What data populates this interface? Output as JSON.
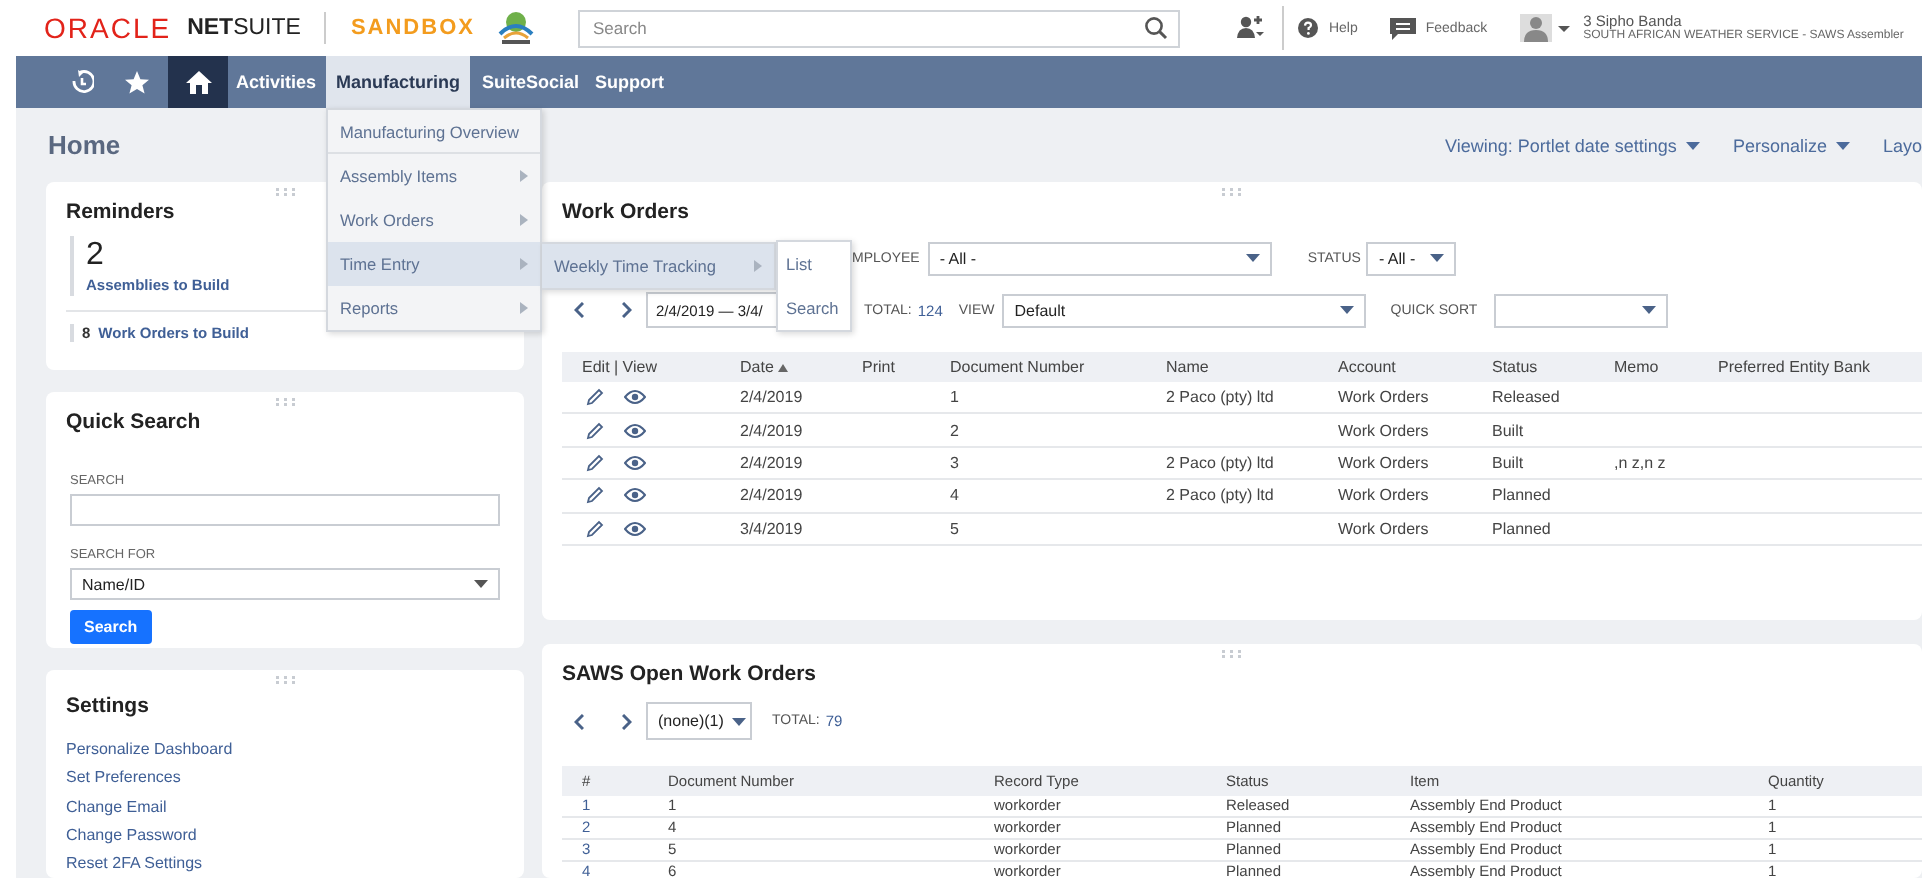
{
  "header": {
    "logo_brand": "ORACLE",
    "logo_product": "**NET**SUITE",
    "environment": "SANDBOX",
    "search": {
      "placeholder": "Search"
    },
    "help": "Help",
    "feedback": "Feedback",
    "user": {
      "name": "3 Sipho Banda",
      "role": "SOUTH AFRICAN WEATHER SERVICE - SAWS Assembler"
    }
  },
  "nav": {
    "icons": [
      {
        "kind": "recent",
        "selected": false
      },
      {
        "kind": "star",
        "selected": false
      },
      {
        "kind": "home",
        "selected": true
      }
    ],
    "tabs": [
      {
        "label": "Activities",
        "selected": false
      },
      {
        "label": "Manufacturing",
        "selected": true
      },
      {
        "label": "SuiteSocial",
        "selected": false
      },
      {
        "label": "Support",
        "selected": false
      }
    ]
  },
  "menu": {
    "items": [
      {
        "label": "Manufacturing Overview",
        "has_submenu": false,
        "expanded": false
      },
      {
        "label": "Assembly Items",
        "has_submenu": true,
        "expanded": false
      },
      {
        "label": "Work Orders",
        "has_submenu": true,
        "expanded": false
      },
      {
        "label": "Time Entry",
        "has_submenu": true,
        "expanded": true,
        "children": [
          {
            "label": "Weekly Time Tracking",
            "has_submenu": true,
            "expanded": true,
            "children": [
              {
                "label": "List",
                "has_submenu": false,
                "expanded": false
              },
              {
                "label": "Search",
                "has_submenu": false,
                "expanded": false
              }
            ]
          }
        ]
      },
      {
        "label": "Reports",
        "has_submenu": true,
        "expanded": false
      }
    ]
  },
  "page": {
    "title": "Home",
    "actions": [
      {
        "label": "Viewing: Portlet date settings",
        "dropdown": true
      },
      {
        "label": "Personalize",
        "dropdown": true
      },
      {
        "label": "Layo",
        "dropdown": false
      }
    ]
  },
  "reminders": {
    "title": "Reminders",
    "count": "2",
    "count_label": "Assemblies to Build",
    "items": [
      {
        "count": "8",
        "label": "Work Orders to Build"
      }
    ]
  },
  "quick_search": {
    "title": "Quick Search",
    "search_label": "SEARCH",
    "search_for_label": "SEARCH FOR",
    "search_for_value": "Name/ID",
    "button": "Search"
  },
  "settings": {
    "title": "Settings",
    "links": [
      "Personalize Dashboard",
      "Set Preferences",
      "Change Email",
      "Change Password",
      "Reset 2FA Settings"
    ]
  },
  "work_orders": {
    "title": "Work Orders",
    "employee_label": "MPLOYEE",
    "employee_value": "- All -",
    "status_label": "STATUS",
    "status_value": "- All -",
    "date_range": "2/4/2019 — 3/4/",
    "total_label": "TOTAL:",
    "total": "124",
    "view_label": "VIEW",
    "view_value": "Default",
    "quick_sort_label": "QUICK SORT",
    "columns": [
      {
        "label": "Edit | View"
      },
      {
        "label": "Date",
        "sorted": true
      },
      {
        "label": "Print"
      },
      {
        "label": "Document Number"
      },
      {
        "label": "Name"
      },
      {
        "label": "Account"
      },
      {
        "label": "Status"
      },
      {
        "label": "Memo"
      },
      {
        "label": "Preferred Entity Bank"
      }
    ],
    "rows": [
      {
        "date": "2/4/2019",
        "document_number": "1",
        "name": "2 Paco (pty) ltd",
        "account": "Work Orders",
        "status": "Released"
      },
      {
        "date": "2/4/2019",
        "document_number": "2",
        "account": "Work Orders",
        "status": "Built"
      },
      {
        "date": "2/4/2019",
        "document_number": "3",
        "name": "2 Paco (pty) ltd",
        "account": "Work Orders",
        "status": "Built",
        "memo": ",n z,n z"
      },
      {
        "date": "2/4/2019",
        "document_number": "4",
        "name": "2 Paco (pty) ltd",
        "account": "Work Orders",
        "status": "Planned"
      },
      {
        "date": "3/4/2019",
        "document_number": "5",
        "account": "Work Orders",
        "status": "Planned"
      }
    ]
  },
  "open_work_orders": {
    "title": "SAWS Open Work Orders",
    "filter_value": "(none)(1)",
    "total_label": "TOTAL:",
    "total": "79",
    "columns": [
      "#",
      "Document Number",
      "Record Type",
      "Status",
      "Item",
      "Quantity"
    ],
    "rows": [
      [
        "1",
        "1",
        "workorder",
        "Released",
        "Assembly End Product",
        "1"
      ],
      [
        "2",
        "4",
        "workorder",
        "Planned",
        "Assembly End Product",
        "1"
      ],
      [
        "3",
        "5",
        "workorder",
        "Planned",
        "Assembly End Product",
        "1"
      ],
      [
        "4",
        "6",
        "workorder",
        "Planned",
        "Assembly End Product",
        "1"
      ]
    ]
  }
}
